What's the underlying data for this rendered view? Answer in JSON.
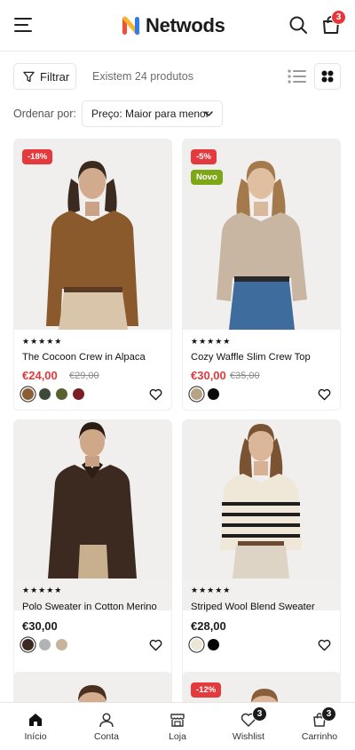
{
  "header": {
    "brand": "Netwods",
    "cart_count": "3",
    "icons": [
      "menu-icon",
      "search-icon",
      "shopping-bag-icon"
    ]
  },
  "toolbar": {
    "filter_label": "Filtrar",
    "results_text": "Existem 24 produtos",
    "sort_label": "Ordenar por:",
    "sort_value": "Preço: Maior para menor"
  },
  "products": [
    {
      "discount": "-18%",
      "badge_new": "",
      "rating_stars": "★★★★★",
      "title": "The Cocoon Crew in Alpaca",
      "price": "€24,00",
      "old_price": "€29,00",
      "swatches": [
        "#8b5e34",
        "#3d4a3a",
        "#59622e",
        "#7a1f24"
      ]
    },
    {
      "discount": "-5%",
      "badge_new": "Novo",
      "rating_stars": "★★★★★",
      "title": "Cozy Waffle Slim Crew Top",
      "price": "€30,00",
      "old_price": "€35,00",
      "swatches": [
        "#b7a286",
        "#0a0a0a"
      ]
    },
    {
      "discount": "",
      "badge_new": "",
      "rating_stars": "★★★★★",
      "title": "Polo Sweater in Cotton Merino",
      "price": "€30,00",
      "old_price": "",
      "swatches": [
        "#3a2a22",
        "#b3b3b3",
        "#c8b49a"
      ]
    },
    {
      "discount": "",
      "badge_new": "",
      "rating_stars": "★★★★★",
      "title": "Striped Wool Blend Sweater",
      "price": "€28,00",
      "old_price": "",
      "swatches": [
        "#ece6d6",
        "#050505"
      ]
    },
    {
      "discount": "",
      "badge_new": ""
    },
    {
      "discount": "-12%",
      "badge_new": ""
    }
  ],
  "bottom_nav": [
    {
      "label": "Início",
      "icon": "home-icon",
      "active": true
    },
    {
      "label": "Conta",
      "icon": "user-icon"
    },
    {
      "label": "Loja",
      "icon": "store-icon"
    },
    {
      "label": "Wishlist",
      "icon": "heart-icon",
      "badge": "3"
    },
    {
      "label": "Carrinho",
      "icon": "shopping-bag-icon",
      "badge": "3"
    }
  ],
  "colors": {
    "sale_red": "#e1393d",
    "new_green": "#7ea718",
    "text_dark": "#1c1c1c"
  }
}
